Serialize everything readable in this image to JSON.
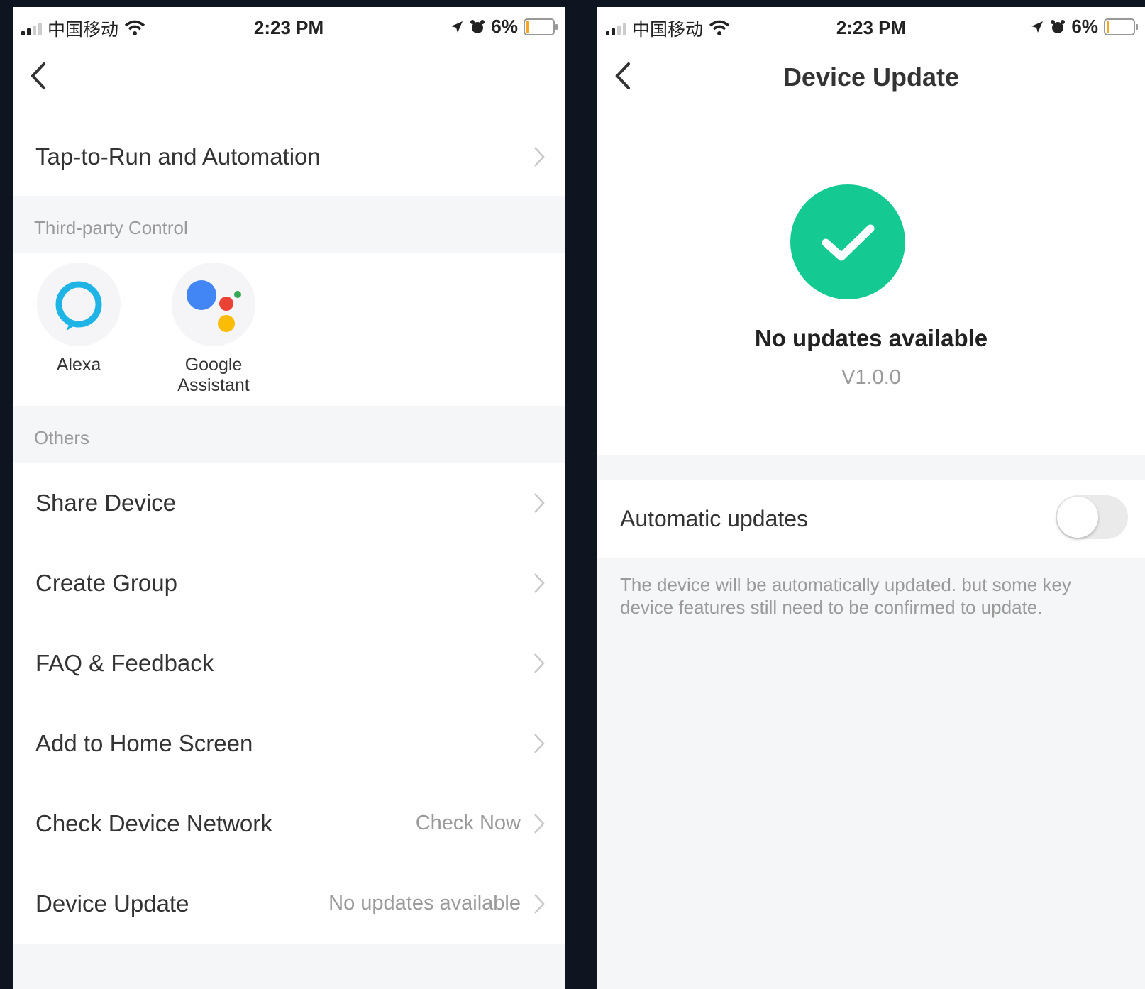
{
  "status_bar": {
    "carrier": "中国移动",
    "time": "2:23 PM",
    "battery": "6%"
  },
  "left_screen": {
    "row_tap_to_run": "Tap-to-Run and Automation",
    "section_third_party": "Third-party Control",
    "third_party": {
      "alexa": "Alexa",
      "google_line1": "Google",
      "google_line2": "Assistant"
    },
    "section_others": "Others",
    "rows": [
      {
        "label": "Share Device",
        "value": ""
      },
      {
        "label": "Create Group",
        "value": ""
      },
      {
        "label": "FAQ & Feedback",
        "value": ""
      },
      {
        "label": "Add to Home Screen",
        "value": ""
      },
      {
        "label": "Check Device Network",
        "value": "Check Now"
      },
      {
        "label": "Device Update",
        "value": "No updates available"
      }
    ]
  },
  "right_screen": {
    "title": "Device Update",
    "status": "No updates available",
    "version": "V1.0.0",
    "auto_updates_label": "Automatic updates",
    "auto_updates_on": false,
    "note": "The device will be automatically updated. but some key device features still need to be confirmed to update."
  },
  "colors": {
    "success": "#15c993",
    "alexa": "#1fb4e6",
    "google_blue": "#4285f4",
    "google_red": "#ea4335",
    "google_yellow": "#fbbc05",
    "google_green": "#34a853"
  }
}
